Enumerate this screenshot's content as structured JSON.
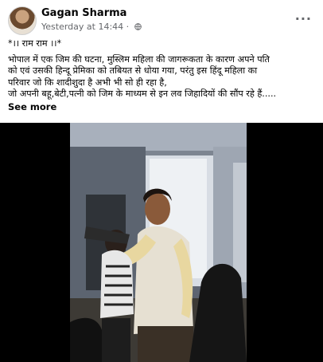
{
  "post": {
    "author": "Gagan Sharma",
    "timestamp": "Yesterday at 14:44",
    "dot": "·",
    "more_icon": "more-horizontal-icon",
    "privacy_icon": "globe-icon",
    "text_lines": [
      "*।। राम राम ।।*",
      "भोपाल में एक जिम की घटना, मुस्लिम महिला की जागरूकता के कारण अपने पति",
      "को एवं उसकी हिन्दू प्रेमिका को तबियत से धोया गया, परंतु इस हिंदू महिला का",
      "परिवार जो कि शादीशुदा है अभी भी सो ही रहा है,",
      "जो अपनी बहू,बेटी,पत्नी को जिम के माध्यम से इन लव जिहादियों की सौंप रहे हैं....."
    ],
    "see_more": "See more"
  },
  "colors": {
    "text": "#050505",
    "secondary": "#65676b",
    "video_bg": "#000000"
  }
}
